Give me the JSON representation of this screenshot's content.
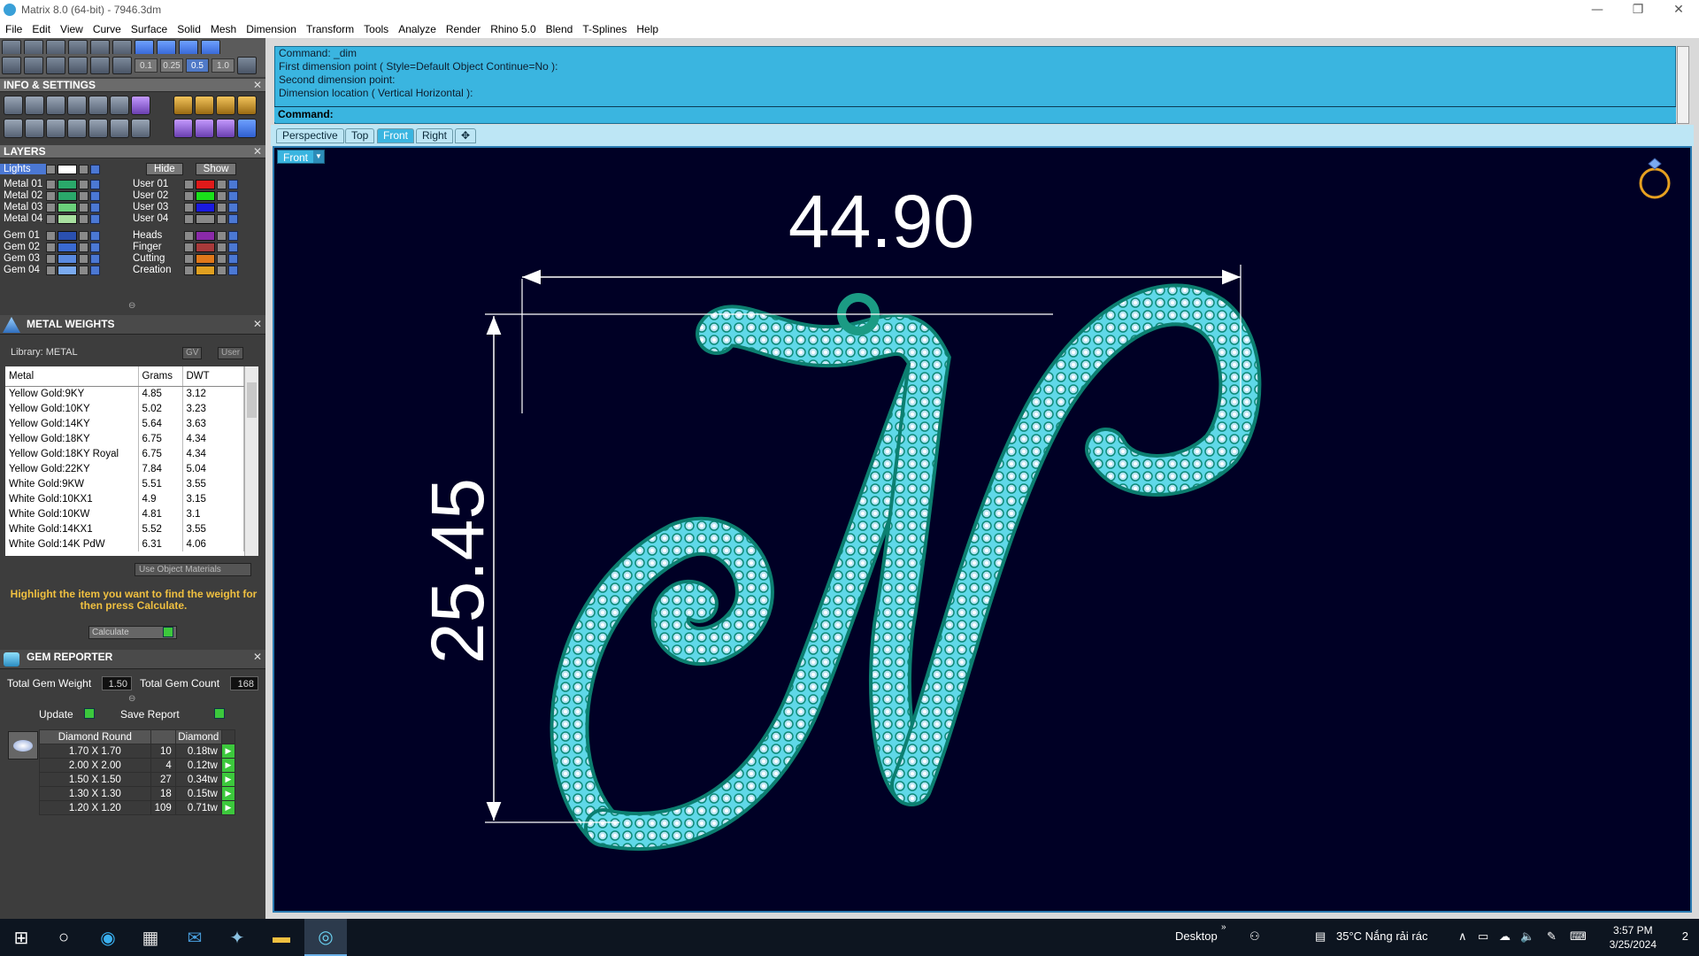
{
  "window": {
    "title": "Matrix 8.0 (64-bit) - 7946.3dm",
    "min": "—",
    "max": "❐",
    "close": "✕"
  },
  "menu": [
    "File",
    "Edit",
    "View",
    "Curve",
    "Surface",
    "Solid",
    "Mesh",
    "Dimension",
    "Transform",
    "Tools",
    "Analyze",
    "Render",
    "Rhino 5.0",
    "Blend",
    "T-Splines",
    "Help"
  ],
  "zoom": [
    "0.1",
    "0.25",
    "0.5",
    "1.0"
  ],
  "info": {
    "title": "INFO & SETTINGS"
  },
  "layers": {
    "title": "LAYERS",
    "lights": "Lights",
    "hide": "Hide",
    "show": "Show",
    "left": [
      {
        "name": "Metal 01",
        "color": "#2aa86a"
      },
      {
        "name": "Metal 02",
        "color": "#2aa86a"
      },
      {
        "name": "Metal 03",
        "color": "#6ad07a"
      },
      {
        "name": "Metal 04",
        "color": "#a8e0a0"
      },
      {
        "name": "Gem 01",
        "color": "#2a50b0"
      },
      {
        "name": "Gem 02",
        "color": "#3a6ad0"
      },
      {
        "name": "Gem 03",
        "color": "#5a8ae0"
      },
      {
        "name": "Gem 04",
        "color": "#7aaaf0"
      }
    ],
    "right": [
      {
        "name": "User 01",
        "color": "#e01a1a"
      },
      {
        "name": "User 02",
        "color": "#1ae01a"
      },
      {
        "name": "User 03",
        "color": "#1a1ae0"
      },
      {
        "name": "User 04",
        "color": "#888888"
      },
      {
        "name": "Heads",
        "color": "#8a2aa8"
      },
      {
        "name": "Finger",
        "color": "#a83a3a"
      },
      {
        "name": "Cutting",
        "color": "#e0781a"
      },
      {
        "name": "Creation",
        "color": "#e0a020"
      }
    ]
  },
  "metal": {
    "title": "METAL WEIGHTS",
    "library": "Library: METAL",
    "gv": "GV",
    "user": "User",
    "headers": [
      "Metal",
      "Grams",
      "DWT"
    ],
    "rows": [
      [
        "Yellow Gold:9KY",
        "4.85",
        "3.12"
      ],
      [
        "Yellow Gold:10KY",
        "5.02",
        "3.23"
      ],
      [
        "Yellow Gold:14KY",
        "5.64",
        "3.63"
      ],
      [
        "Yellow Gold:18KY",
        "6.75",
        "4.34"
      ],
      [
        "Yellow Gold:18KY Royal",
        "6.75",
        "4.34"
      ],
      [
        "Yellow Gold:22KY",
        "7.84",
        "5.04"
      ],
      [
        "White Gold:9KW",
        "5.51",
        "3.55"
      ],
      [
        "White Gold:10KX1",
        "4.9",
        "3.15"
      ],
      [
        "White Gold:10KW",
        "4.81",
        "3.1"
      ],
      [
        "White Gold:14KX1",
        "5.52",
        "3.55"
      ],
      [
        "White Gold:14K PdW",
        "6.31",
        "4.06"
      ]
    ],
    "use_object": "Use Object Materials",
    "hint": "Highlight the item you want to find the weight for then press Calculate.",
    "calculate": "Calculate"
  },
  "gem": {
    "title": "GEM REPORTER",
    "total_weight_label": "Total Gem Weight",
    "total_weight": "1.50",
    "total_count_label": "Total Gem Count",
    "total_count": "168",
    "update": "Update",
    "save": "Save Report",
    "headers": [
      "Diamond Round",
      "",
      "Diamond"
    ],
    "rows": [
      [
        "1.70 X 1.70",
        "10",
        "0.18tw"
      ],
      [
        "2.00 X 2.00",
        "4",
        "0.12tw"
      ],
      [
        "1.50 X 1.50",
        "27",
        "0.34tw"
      ],
      [
        "1.30 X 1.30",
        "18",
        "0.15tw"
      ],
      [
        "1.20 X 1.20",
        "109",
        "0.71tw"
      ]
    ]
  },
  "command": {
    "lines": [
      "Command: _dim",
      "First dimension point ( Style=Default  Object  Continue=No ):",
      "Second dimension point:",
      "Dimension location ( Vertical  Horizontal ):"
    ],
    "prompt": "Command:"
  },
  "tabs": [
    "Perspective",
    "Top",
    "Front",
    "Right"
  ],
  "tab_add": "✥",
  "viewport": {
    "label": "Front",
    "dim_horizontal": "44.90",
    "dim_vertical": "25.45"
  },
  "taskbar": {
    "desktop": "Desktop",
    "weather": "35°C  Nắng rải rác",
    "time": "3:57 PM",
    "date": "3/25/2024",
    "notif": "2"
  }
}
